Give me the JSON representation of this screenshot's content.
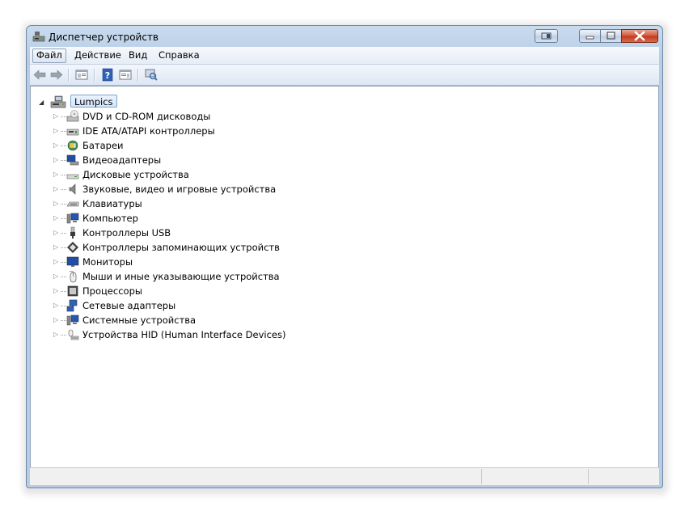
{
  "window": {
    "title": "Диспетчер устройств"
  },
  "menu": [
    "Файл",
    "Действие",
    "Вид",
    "Справка"
  ],
  "tree": {
    "root_label": "Lumpics",
    "items": [
      {
        "label": "DVD и CD-ROM дисководы",
        "icon": "dvd-drive-icon"
      },
      {
        "label": "IDE ATA/ATAPI контроллеры",
        "icon": "ide-controller-icon"
      },
      {
        "label": "Батареи",
        "icon": "battery-icon"
      },
      {
        "label": "Видеоадаптеры",
        "icon": "display-adapter-icon"
      },
      {
        "label": "Дисковые устройства",
        "icon": "disk-drive-icon"
      },
      {
        "label": "Звуковые, видео и игровые устройства",
        "icon": "speaker-icon"
      },
      {
        "label": "Клавиатуры",
        "icon": "keyboard-icon"
      },
      {
        "label": "Компьютер",
        "icon": "computer-icon"
      },
      {
        "label": "Контроллеры USB",
        "icon": "usb-icon"
      },
      {
        "label": "Контроллеры запоминающих устройств",
        "icon": "storage-controller-icon"
      },
      {
        "label": "Мониторы",
        "icon": "monitor-icon"
      },
      {
        "label": "Мыши и иные указывающие устройства",
        "icon": "mouse-icon"
      },
      {
        "label": "Процессоры",
        "icon": "processor-icon"
      },
      {
        "label": "Сетевые адаптеры",
        "icon": "network-adapter-icon"
      },
      {
        "label": "Системные устройства",
        "icon": "system-devices-icon"
      },
      {
        "label": "Устройства HID (Human Interface Devices)",
        "icon": "hid-icon"
      }
    ]
  }
}
